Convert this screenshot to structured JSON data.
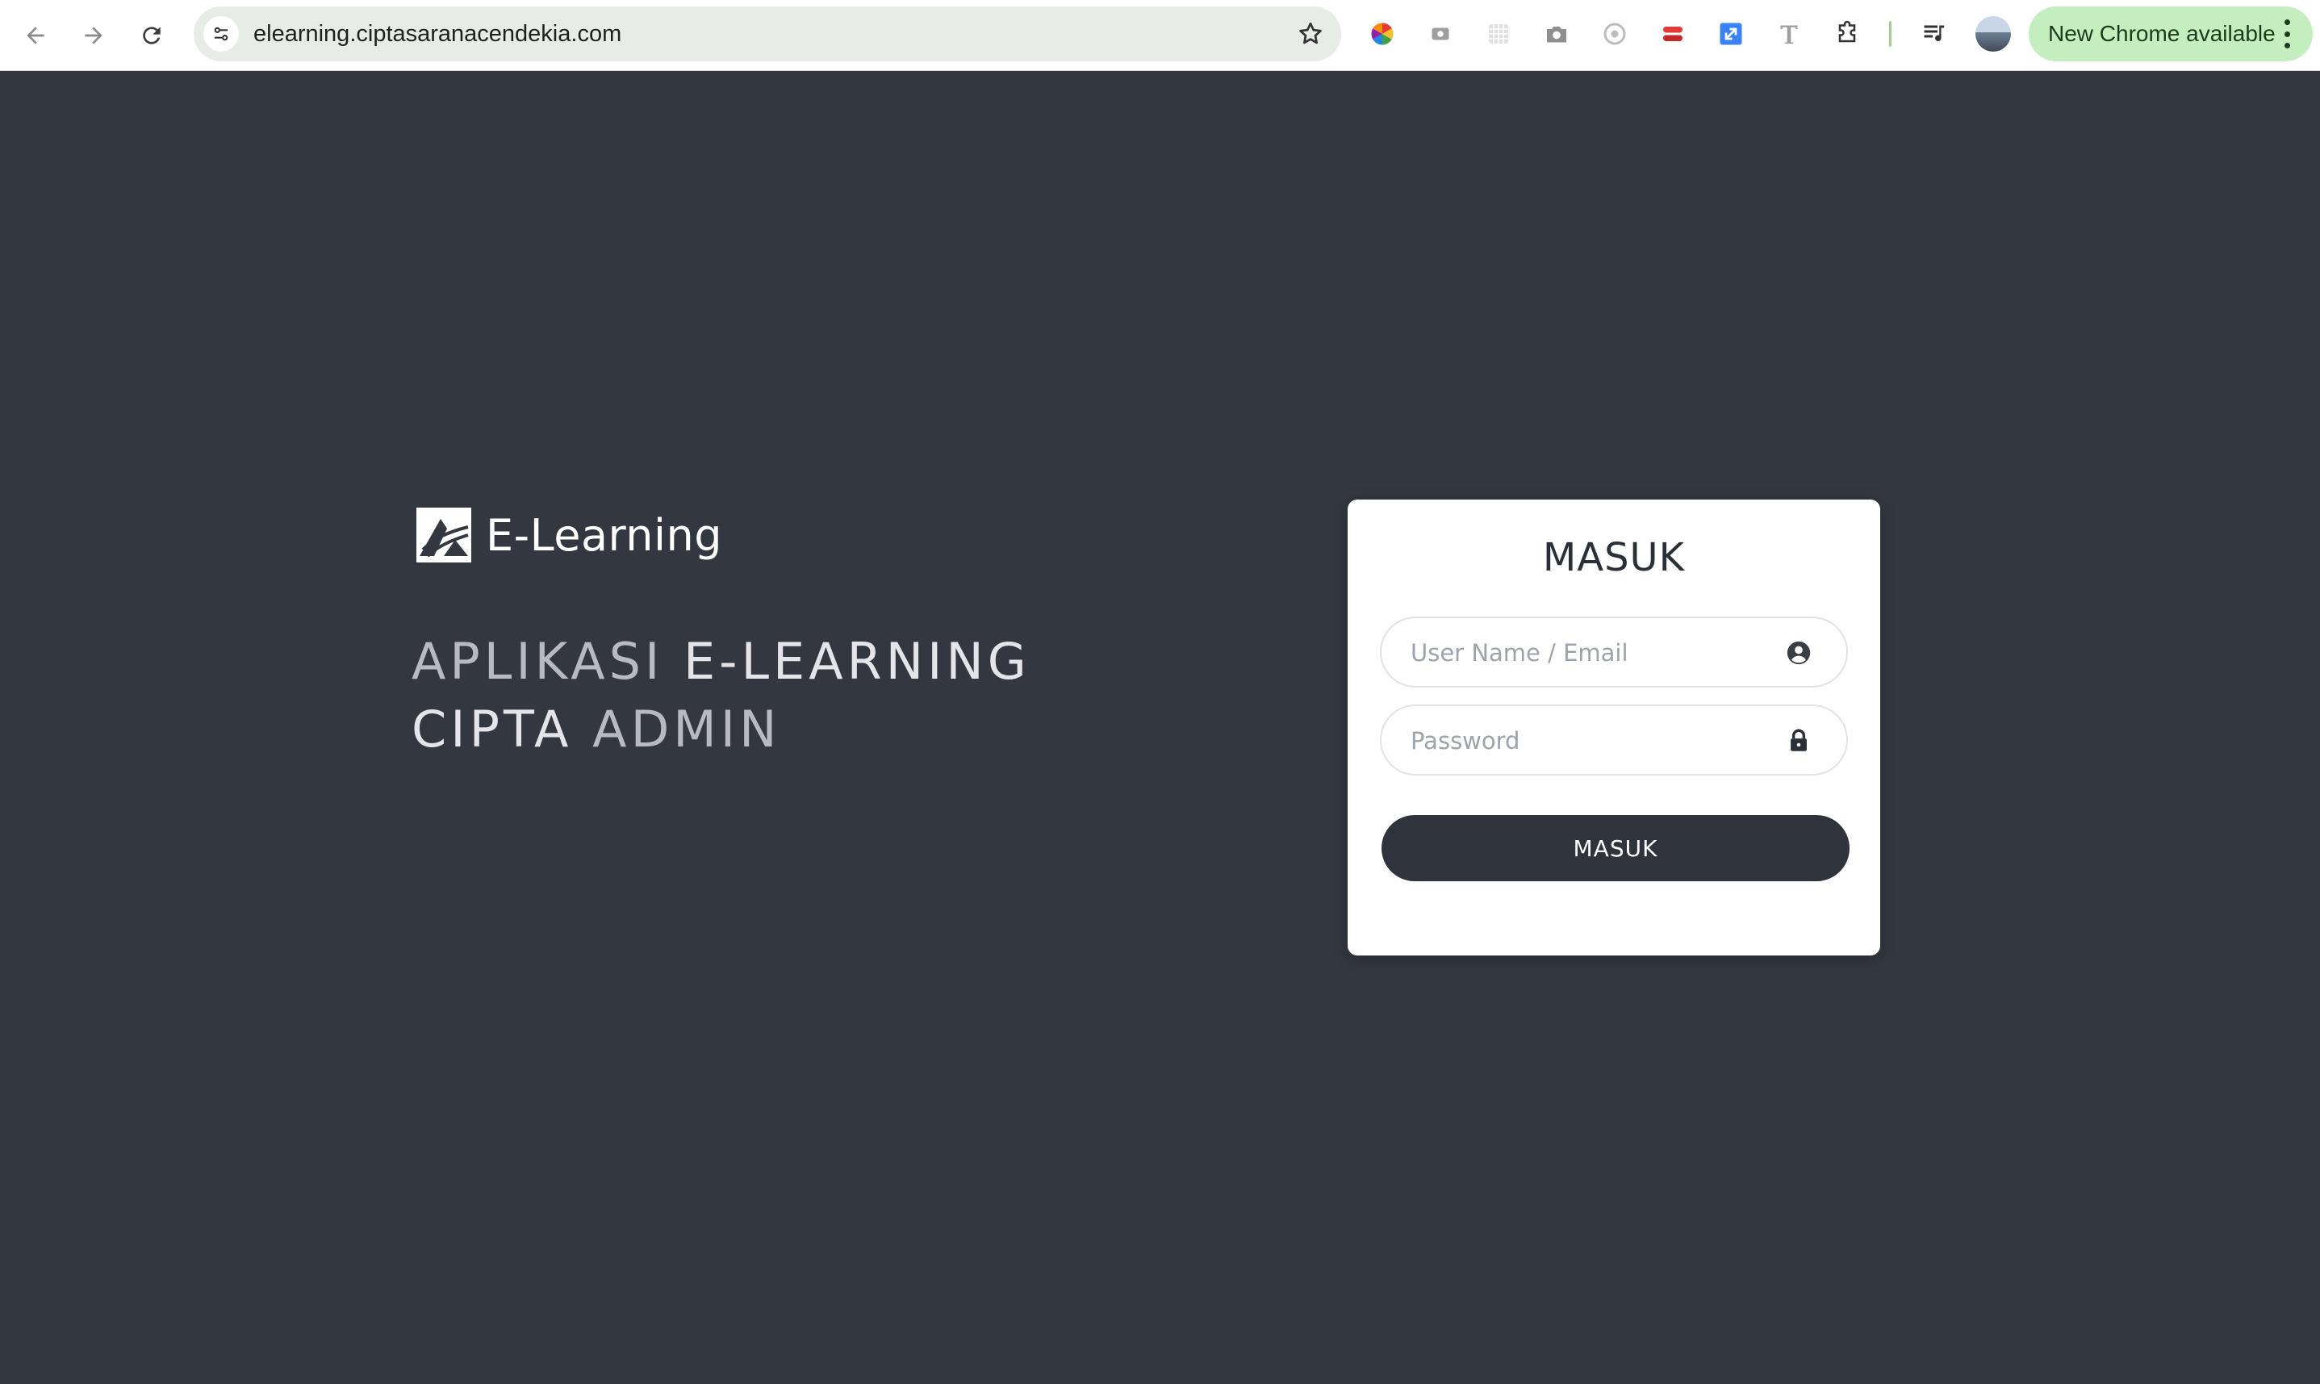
{
  "browser": {
    "url": "elearning.ciptasaranacendekia.com",
    "update_label": "New Chrome available",
    "extensions": [
      "color-wheel-icon",
      "screen-capture-icon",
      "grid-extension-icon",
      "camera-icon",
      "eye-dropper-icon",
      "red-shapes-icon",
      "resize-arrow-icon",
      "font-t-icon",
      "puzzle-extensions-icon",
      "media-playlist-icon"
    ]
  },
  "brand": {
    "name": "E-Learning",
    "logo_icon": "mountain-logo-icon"
  },
  "tagline": {
    "line1_a": "APLIKASI ",
    "line1_b": "E-LEARNING",
    "line2_a": "CIPTA ",
    "line2_b": "ADMIN"
  },
  "login": {
    "title": "MASUK",
    "username_placeholder": "User Name / Email",
    "username_value": "",
    "password_placeholder": "Password",
    "password_value": "",
    "submit_label": "MASUK"
  },
  "colors": {
    "page_background": "#333740",
    "card_background": "#ffffff",
    "button_background": "#2f333b",
    "update_pill": "#c5eec0"
  }
}
